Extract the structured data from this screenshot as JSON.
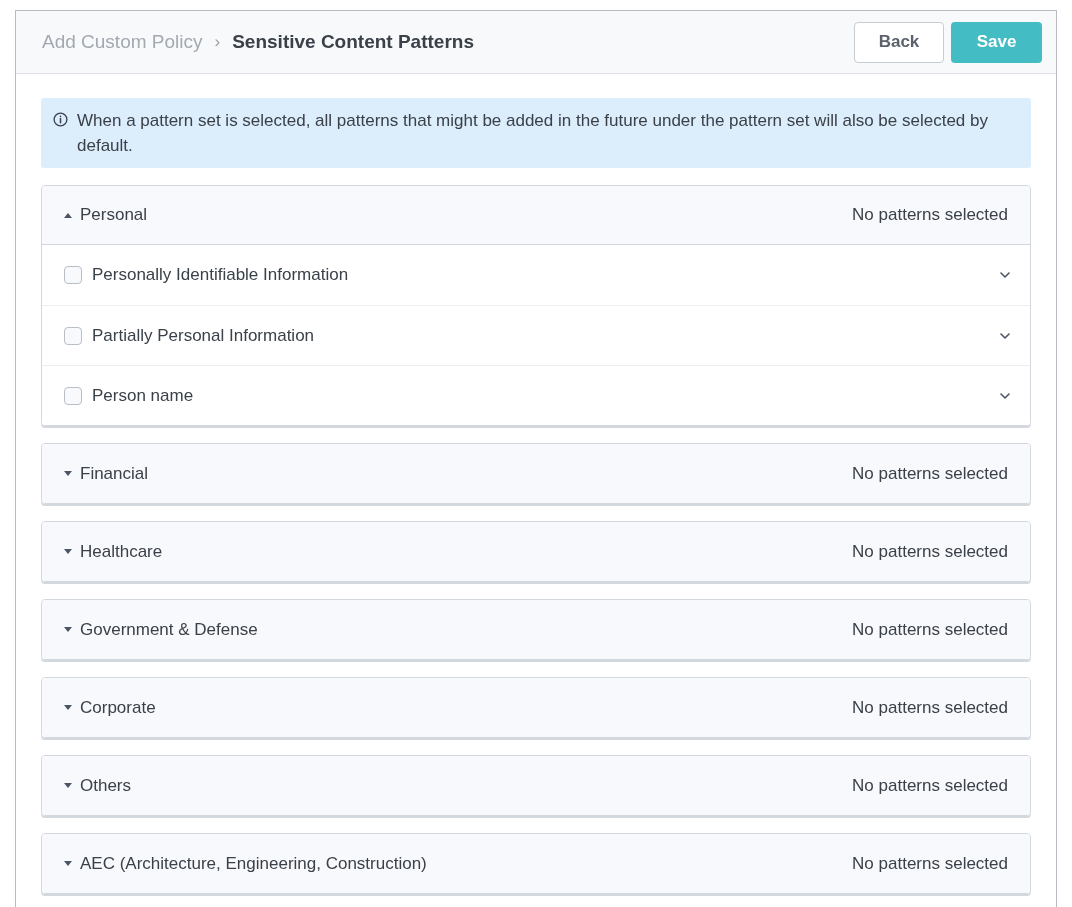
{
  "breadcrumb": {
    "parent": "Add Custom Policy",
    "separator": "›",
    "current": "Sensitive Content Patterns"
  },
  "buttons": {
    "back": "Back",
    "save": "Save"
  },
  "notice": "When a pattern set is selected, all patterns that might be added in the future under the pattern set will also be selected by default.",
  "groups": [
    {
      "title": "Personal",
      "status": "No patterns selected",
      "expanded": true,
      "items": [
        {
          "label": "Personally Identifiable Information",
          "checked": false,
          "expanded": false
        },
        {
          "label": "Partially Personal Information",
          "checked": false,
          "expanded": false
        },
        {
          "label": "Person name",
          "checked": false,
          "expanded": false
        }
      ]
    },
    {
      "title": "Financial",
      "status": "No patterns selected",
      "expanded": false
    },
    {
      "title": "Healthcare",
      "status": "No patterns selected",
      "expanded": false
    },
    {
      "title": "Government & Defense",
      "status": "No patterns selected",
      "expanded": false
    },
    {
      "title": "Corporate",
      "status": "No patterns selected",
      "expanded": false
    },
    {
      "title": "Others",
      "status": "No patterns selected",
      "expanded": false
    },
    {
      "title": "AEC (Architecture, Engineering, Construction)",
      "status": "No patterns selected",
      "expanded": false
    }
  ]
}
